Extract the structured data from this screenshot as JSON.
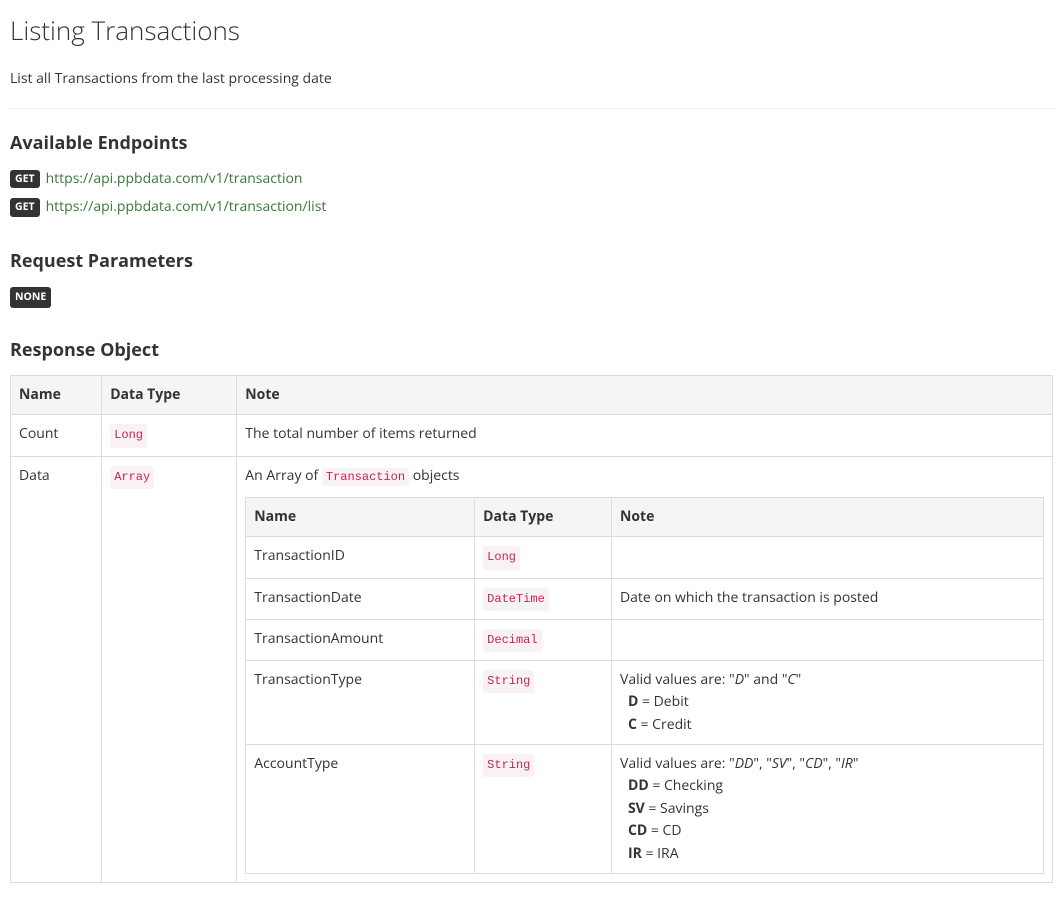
{
  "page": {
    "title": "Listing Transactions",
    "subtitle": "List all Transactions from the last processing date"
  },
  "endpoints": {
    "heading": "Available Endpoints",
    "items": [
      {
        "method": "GET",
        "url": "https://api.ppbdata.com/v1/transaction"
      },
      {
        "method": "GET",
        "url": "https://api.ppbdata.com/v1/transaction/list"
      }
    ]
  },
  "request": {
    "heading": "Request Parameters",
    "none_label": "NONE"
  },
  "response": {
    "heading": "Response Object",
    "columns": {
      "name": "Name",
      "dataType": "Data Type",
      "note": "Note"
    },
    "rows": {
      "count": {
        "name": "Count",
        "type": "Long",
        "note": "The total number of items returned"
      },
      "data": {
        "name": "Data",
        "type": "Array",
        "note_prefix": "An Array of ",
        "note_code": "Transaction",
        "note_suffix": " objects",
        "nested_columns": {
          "name": "Name",
          "dataType": "Data Type",
          "note": "Note"
        },
        "nested": {
          "transactionId": {
            "name": "TransactionID",
            "type": "Long",
            "note": ""
          },
          "transactionDate": {
            "name": "TransactionDate",
            "type": "DateTime",
            "note": "Date on which the transaction is posted"
          },
          "transactionAmount": {
            "name": "TransactionAmount",
            "type": "Decimal",
            "note": ""
          },
          "transactionType": {
            "name": "TransactionType",
            "type": "String",
            "valid_prefix": "Valid values are: \"",
            "v1": "D",
            "mid1": "\" and \"",
            "v2": "C",
            "end": "\"",
            "d_code": "D",
            "d_label": " = Debit",
            "c_code": "C",
            "c_label": " = Credit"
          },
          "accountType": {
            "name": "AccountType",
            "type": "String",
            "valid_prefix": "Valid values are: \"",
            "v1": "DD",
            "s1": "\", \"",
            "v2": "SV",
            "s2": "\", \"",
            "v3": "CD",
            "s3": "\", \"",
            "v4": "IR",
            "end": "\"",
            "dd_code": "DD",
            "dd_label": " = Checking",
            "sv_code": "SV",
            "sv_label": " = Savings",
            "cd_code": "CD",
            "cd_label": " = CD",
            "ir_code": "IR",
            "ir_label": " = IRA"
          }
        }
      }
    }
  }
}
